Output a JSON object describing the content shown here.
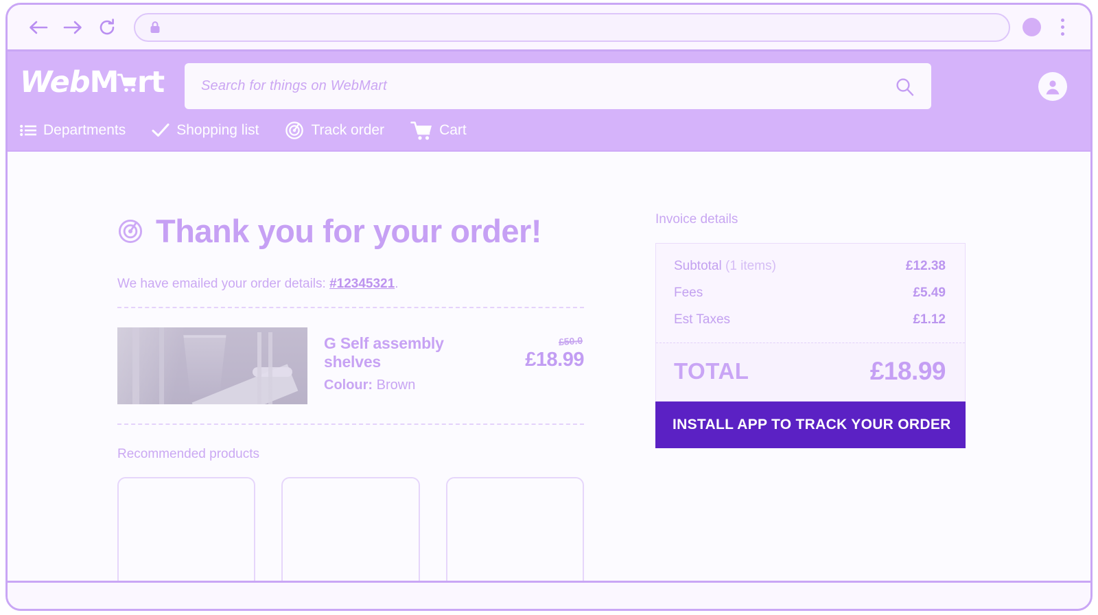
{
  "browser": {
    "back_icon": "arrow-left-icon",
    "forward_icon": "arrow-right-icon",
    "reload_icon": "reload-icon",
    "lock_icon": "lock-icon",
    "url_value": "",
    "url_placeholder": "",
    "profile_icon": "profile-avatar-icon",
    "menu_icon": "kebab-menu-icon"
  },
  "header": {
    "logo_web": "Web",
    "logo_m": "M",
    "logo_rt": "rt",
    "logo_cart_icon": "shopping-cart-icon",
    "search": {
      "placeholder": "Search for things on WebMart",
      "value": "",
      "icon": "search-icon"
    },
    "account_icon": "account-circle-icon",
    "nav": [
      {
        "label": "Departments",
        "icon": "list-menu-icon"
      },
      {
        "label": "Shopping list",
        "icon": "check-icon"
      },
      {
        "label": "Track order",
        "icon": "radar-target-icon"
      },
      {
        "label": "Cart",
        "icon": "shopping-cart-icon"
      }
    ]
  },
  "main": {
    "thankyou_icon": "radar-target-icon",
    "thankyou_heading": "Thank you for your order!",
    "emailed_prefix": "We have emailed your order details: ",
    "order_number": "#12345321",
    "emailed_suffix": ".",
    "order_item": {
      "image_alt": "product-photo",
      "title": "G Self assembly shelves",
      "colour_label": "Colour:",
      "colour_value": "Brown",
      "price_original": "£50.0",
      "price_current": "£18.99"
    },
    "recommended_title": "Recommended products",
    "recommended_cards": [
      "",
      "",
      ""
    ]
  },
  "invoice": {
    "title": "Invoice details",
    "rows": [
      {
        "label": "Subtotal",
        "note": " (1 items)",
        "value": "£12.38"
      },
      {
        "label": "Fees",
        "note": "",
        "value": "£5.49"
      },
      {
        "label": "Est Taxes",
        "note": "",
        "value": "£1.12"
      }
    ],
    "total_label": "TOTAL",
    "total_value": "£18.99",
    "install_button": "INSTALL APP TO TRACK YOUR ORDER"
  },
  "colors": {
    "brand_header": "#d5b3fa",
    "accent_text": "#c6a0f4",
    "cta_background": "#5b21c4",
    "page_background": "#fcfbff",
    "frame_border": "#c9a6f5"
  }
}
